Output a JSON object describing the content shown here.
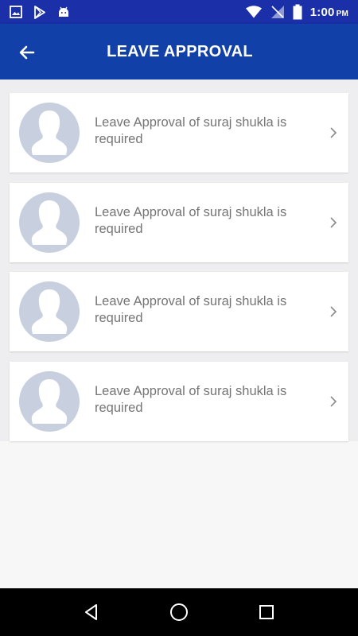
{
  "status_bar": {
    "time": "1:00",
    "ampm": "PM",
    "icons": [
      "gallery-icon",
      "play-store-icon",
      "android-icon",
      "wifi-icon",
      "no-signal-icon",
      "battery-icon"
    ]
  },
  "header": {
    "title": "LEAVE APPROVAL",
    "back_icon": "arrow-left-icon",
    "color": "#1140a8"
  },
  "list": {
    "items": [
      {
        "text": "Leave Approval of suraj shukla is required"
      },
      {
        "text": "Leave Approval of suraj shukla is required"
      },
      {
        "text": "Leave Approval of suraj shukla is required"
      },
      {
        "text": "Leave Approval of suraj shukla is required"
      }
    ]
  },
  "nav_bar": {
    "buttons": [
      "back-triangle-icon",
      "home-circle-icon",
      "recents-square-icon"
    ]
  }
}
